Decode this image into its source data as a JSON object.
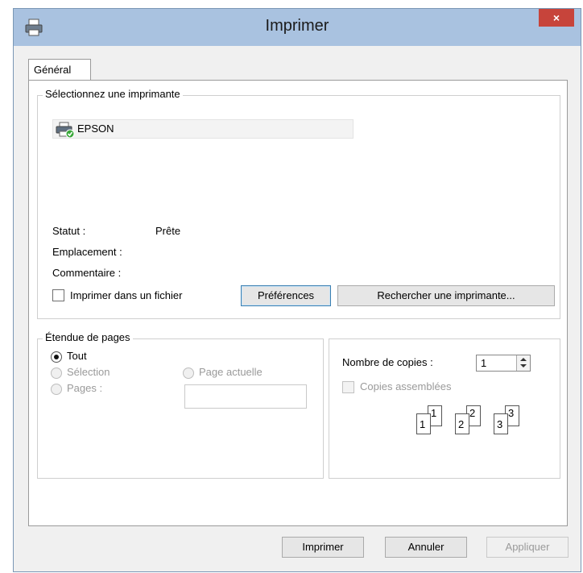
{
  "window": {
    "title": "Imprimer",
    "close_glyph": "×"
  },
  "tabs": [
    {
      "label": "Général"
    }
  ],
  "printer_group": {
    "legend": "Sélectionnez une imprimante",
    "printers": [
      {
        "name": "EPSON",
        "icon": "printer-ready-icon"
      }
    ],
    "status_label": "Statut :",
    "status_value": "Prête",
    "location_label": "Emplacement :",
    "location_value": "",
    "comment_label": "Commentaire :",
    "comment_value": "",
    "print_to_file": {
      "label": "Imprimer dans un fichier",
      "checked": false
    },
    "preferences_button": "Préférences",
    "find_printer_button": "Rechercher une imprimante..."
  },
  "page_range": {
    "legend": "Étendue de pages",
    "options": [
      {
        "label": "Tout",
        "checked": true,
        "enabled": true
      },
      {
        "label": "Sélection",
        "checked": false,
        "enabled": false
      },
      {
        "label": "Page actuelle",
        "checked": false,
        "enabled": false
      },
      {
        "label": "Pages :",
        "checked": false,
        "enabled": false
      }
    ],
    "pages_value": ""
  },
  "copies": {
    "label": "Nombre de copies :",
    "value": "1",
    "collate": {
      "label": "Copies assemblées",
      "checked": false,
      "enabled": false
    },
    "collate_numbers": [
      "1",
      "1",
      "2",
      "2",
      "3",
      "3"
    ]
  },
  "buttons": {
    "print": "Imprimer",
    "cancel": "Annuler",
    "apply": "Appliquer"
  },
  "colors": {
    "titlebar": "#a9c2e0",
    "close": "#c7443b",
    "ready_badge": "#3aa83a"
  }
}
